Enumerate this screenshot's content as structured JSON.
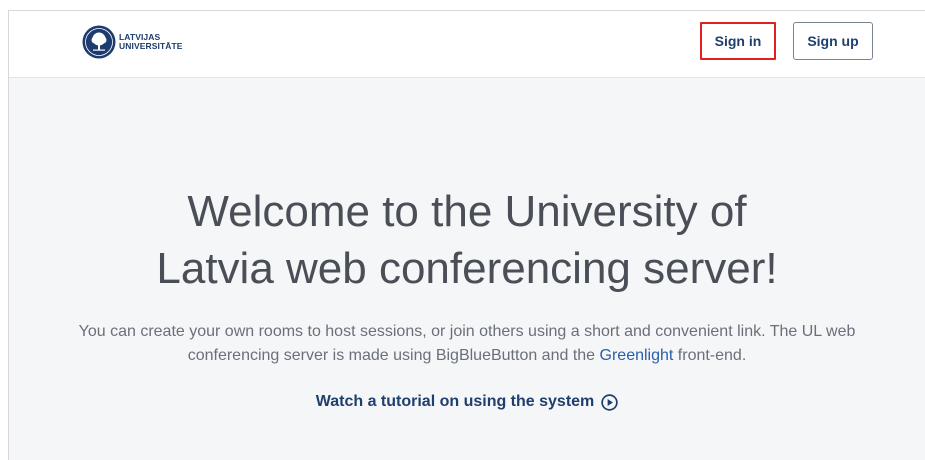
{
  "header": {
    "logo_line1": "LATVIJAS",
    "logo_line2": "UNIVERSITĀTE",
    "signin_label": "Sign in",
    "signup_label": "Sign up"
  },
  "hero": {
    "title_line1": "Welcome to the University of",
    "title_line2": "Latvia web conferencing server!",
    "text_before_link": "You can create your own rooms to host sessions, or join others using a short and convenient link. The UL web conferencing server is made using BigBlueButton and the ",
    "link_text": "Greenlight",
    "text_after_link": " front-end.",
    "tutorial_label": "Watch a tutorial on using the system"
  },
  "icons": {
    "logo": "university-seal-icon",
    "tutorial": "play-circle-icon"
  },
  "colors": {
    "brand_navy": "#1e3f6e",
    "link_blue": "#2b5fa6",
    "highlight_red": "#e02020",
    "page_bg": "#f5f6f7"
  }
}
